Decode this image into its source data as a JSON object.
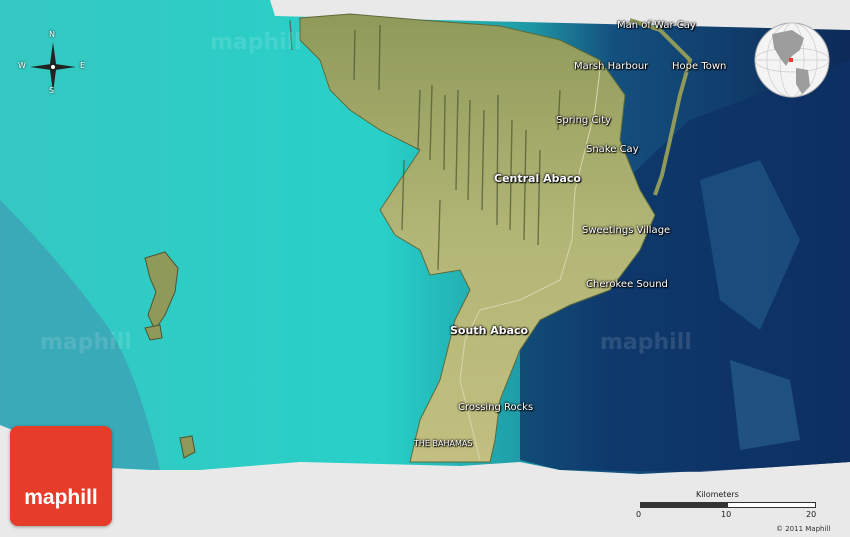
{
  "map": {
    "places": [
      {
        "id": "man-of-war-cay",
        "name": "Man of War Cay"
      },
      {
        "id": "marsh-harbour",
        "name": "Marsh Harbour"
      },
      {
        "id": "hope-town",
        "name": "Hope Town"
      },
      {
        "id": "spring-city",
        "name": "Spring City"
      },
      {
        "id": "snake-cay",
        "name": "Snake Cay"
      },
      {
        "id": "central-abaco",
        "name": "Central Abaco"
      },
      {
        "id": "sweetings-village",
        "name": "Sweetings Village"
      },
      {
        "id": "cherokee-sound",
        "name": "Cherokee Sound"
      },
      {
        "id": "south-abaco",
        "name": "South Abaco"
      },
      {
        "id": "crossing-rocks",
        "name": "Crossing Rocks"
      },
      {
        "id": "the-bahamas",
        "name": "THE BAHAMAS"
      }
    ],
    "compass": {
      "n": "N",
      "s": "S",
      "e": "E",
      "w": "W"
    },
    "scale": {
      "title": "Kilometers",
      "ticks": [
        "0",
        "10",
        "20"
      ]
    },
    "copyright": "© 2011 Maphill",
    "logo": "maphill",
    "colors": {
      "shallow": "#2fc9c2",
      "deep": "#0c2a5a",
      "land": "#a9b070",
      "logo": "#e53d2a"
    }
  }
}
